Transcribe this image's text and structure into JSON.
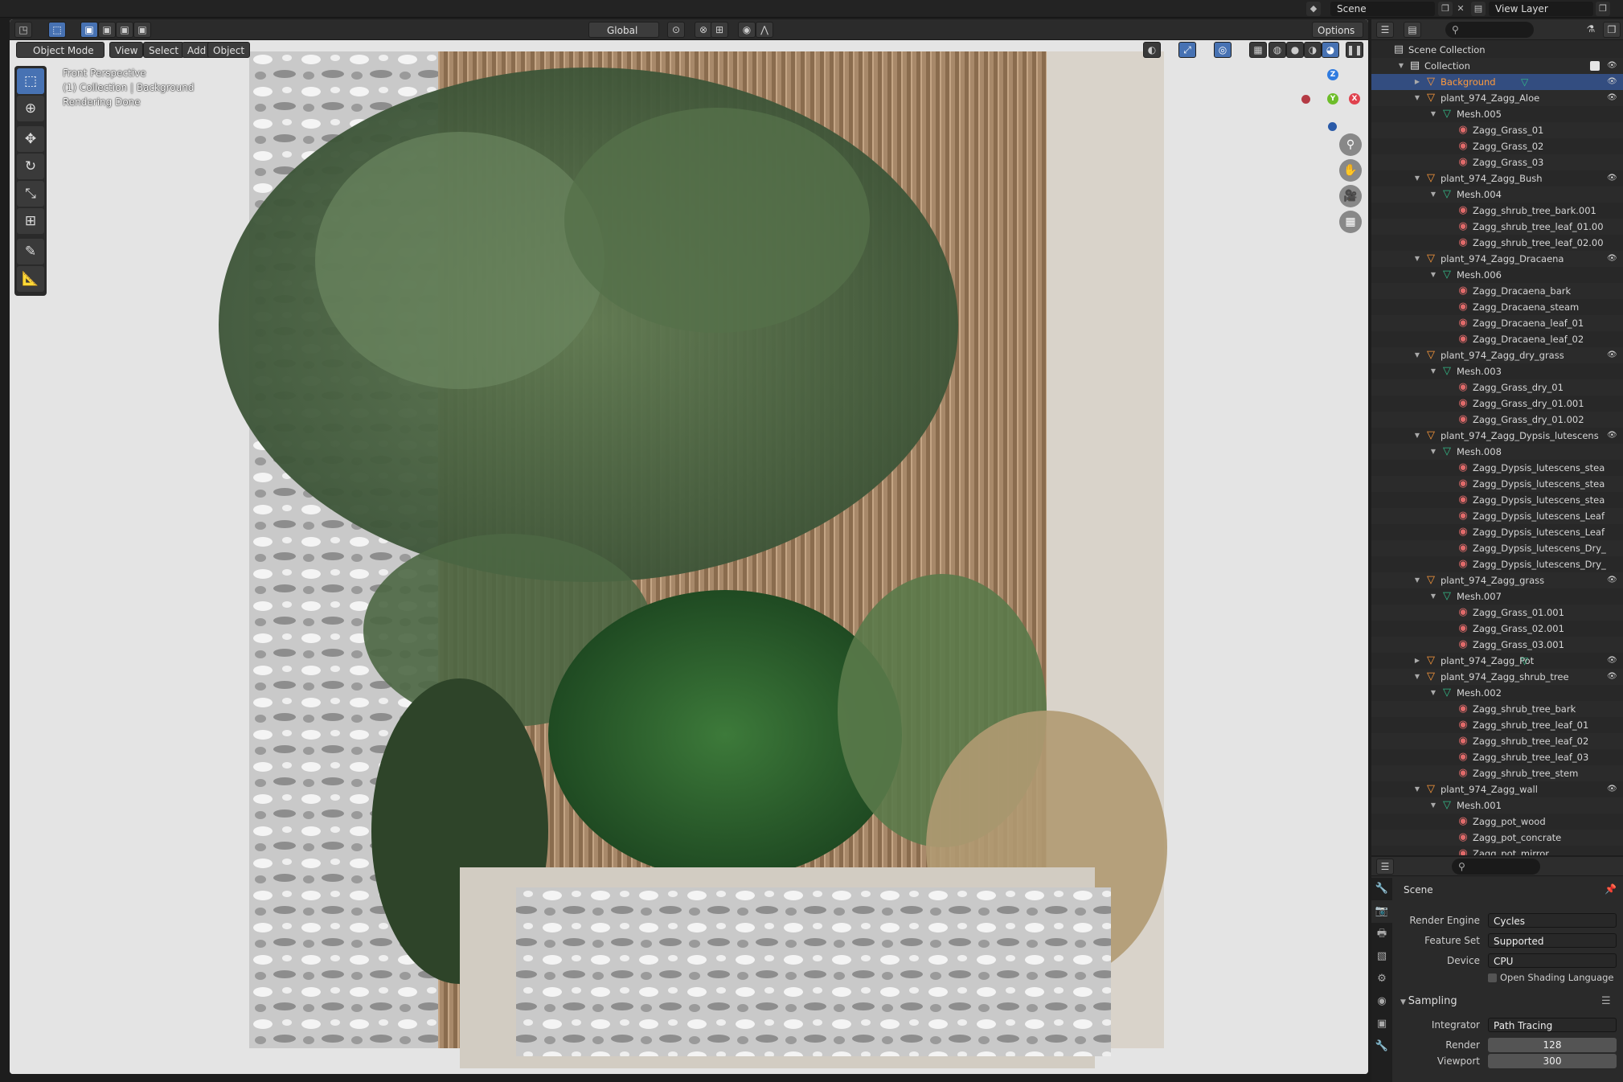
{
  "topbar": {
    "scene_label": "Scene",
    "view_layer_label": "View Layer"
  },
  "viewport": {
    "mode": "Object Mode",
    "menus": [
      "View",
      "Select",
      "Add",
      "Object"
    ],
    "orientation": "Global",
    "options": "Options",
    "overlay_lines": [
      "Front Perspective",
      "(1) Collection | Background",
      "Rendering Done"
    ],
    "gizmo": {
      "z": "Z",
      "y": "Y",
      "x": "X"
    }
  },
  "outliner": {
    "search_placeholder": "",
    "rows": [
      {
        "label": "Scene Collection",
        "depth": 0,
        "icon": "scene-collection-icon",
        "tri": ""
      },
      {
        "label": "Collection",
        "depth": 1,
        "icon": "collection-icon",
        "tri": "▼",
        "check": true,
        "eye": true
      },
      {
        "label": "Background",
        "depth": 2,
        "icon": "object-icon",
        "tri": "▶",
        "eye": true,
        "selected": true,
        "mesh_data": true
      },
      {
        "label": "plant_974_Zagg_Aloe",
        "depth": 2,
        "icon": "object-icon",
        "tri": "▼",
        "eye": true
      },
      {
        "label": "Mesh.005",
        "depth": 3,
        "icon": "mesh-icon",
        "tri": "▼"
      },
      {
        "label": "Zagg_Grass_01",
        "depth": 4,
        "icon": "material-icon"
      },
      {
        "label": "Zagg_Grass_02",
        "depth": 4,
        "icon": "material-icon"
      },
      {
        "label": "Zagg_Grass_03",
        "depth": 4,
        "icon": "material-icon"
      },
      {
        "label": "plant_974_Zagg_Bush",
        "depth": 2,
        "icon": "object-icon",
        "tri": "▼",
        "eye": true
      },
      {
        "label": "Mesh.004",
        "depth": 3,
        "icon": "mesh-icon",
        "tri": "▼"
      },
      {
        "label": "Zagg_shrub_tree_bark.001",
        "depth": 4,
        "icon": "material-icon"
      },
      {
        "label": "Zagg_shrub_tree_leaf_01.00",
        "depth": 4,
        "icon": "material-icon"
      },
      {
        "label": "Zagg_shrub_tree_leaf_02.00",
        "depth": 4,
        "icon": "material-icon"
      },
      {
        "label": "plant_974_Zagg_Dracaena",
        "depth": 2,
        "icon": "object-icon",
        "tri": "▼",
        "eye": true
      },
      {
        "label": "Mesh.006",
        "depth": 3,
        "icon": "mesh-icon",
        "tri": "▼"
      },
      {
        "label": "Zagg_Dracaena_bark",
        "depth": 4,
        "icon": "material-icon"
      },
      {
        "label": "Zagg_Dracaena_steam",
        "depth": 4,
        "icon": "material-icon"
      },
      {
        "label": "Zagg_Dracaena_leaf_01",
        "depth": 4,
        "icon": "material-icon"
      },
      {
        "label": "Zagg_Dracaena_leaf_02",
        "depth": 4,
        "icon": "material-icon"
      },
      {
        "label": "plant_974_Zagg_dry_grass",
        "depth": 2,
        "icon": "object-icon",
        "tri": "▼",
        "eye": true
      },
      {
        "label": "Mesh.003",
        "depth": 3,
        "icon": "mesh-icon",
        "tri": "▼"
      },
      {
        "label": "Zagg_Grass_dry_01",
        "depth": 4,
        "icon": "material-icon"
      },
      {
        "label": "Zagg_Grass_dry_01.001",
        "depth": 4,
        "icon": "material-icon"
      },
      {
        "label": "Zagg_Grass_dry_01.002",
        "depth": 4,
        "icon": "material-icon"
      },
      {
        "label": "plant_974_Zagg_Dypsis_lutescens",
        "depth": 2,
        "icon": "object-icon",
        "tri": "▼",
        "eye": true
      },
      {
        "label": "Mesh.008",
        "depth": 3,
        "icon": "mesh-icon",
        "tri": "▼"
      },
      {
        "label": "Zagg_Dypsis_lutescens_stea",
        "depth": 4,
        "icon": "material-icon"
      },
      {
        "label": "Zagg_Dypsis_lutescens_stea",
        "depth": 4,
        "icon": "material-icon"
      },
      {
        "label": "Zagg_Dypsis_lutescens_stea",
        "depth": 4,
        "icon": "material-icon"
      },
      {
        "label": "Zagg_Dypsis_lutescens_Leaf",
        "depth": 4,
        "icon": "material-icon"
      },
      {
        "label": "Zagg_Dypsis_lutescens_Leaf",
        "depth": 4,
        "icon": "material-icon"
      },
      {
        "label": "Zagg_Dypsis_lutescens_Dry_",
        "depth": 4,
        "icon": "material-icon"
      },
      {
        "label": "Zagg_Dypsis_lutescens_Dry_",
        "depth": 4,
        "icon": "material-icon"
      },
      {
        "label": "plant_974_Zagg_grass",
        "depth": 2,
        "icon": "object-icon",
        "tri": "▼",
        "eye": true
      },
      {
        "label": "Mesh.007",
        "depth": 3,
        "icon": "mesh-icon",
        "tri": "▼"
      },
      {
        "label": "Zagg_Grass_01.001",
        "depth": 4,
        "icon": "material-icon"
      },
      {
        "label": "Zagg_Grass_02.001",
        "depth": 4,
        "icon": "material-icon"
      },
      {
        "label": "Zagg_Grass_03.001",
        "depth": 4,
        "icon": "material-icon"
      },
      {
        "label": "plant_974_Zagg_Pot",
        "depth": 2,
        "icon": "object-icon",
        "tri": "▶",
        "eye": true,
        "mesh_data": true
      },
      {
        "label": "plant_974_Zagg_shrub_tree",
        "depth": 2,
        "icon": "object-icon",
        "tri": "▼",
        "eye": true
      },
      {
        "label": "Mesh.002",
        "depth": 3,
        "icon": "mesh-icon",
        "tri": "▼"
      },
      {
        "label": "Zagg_shrub_tree_bark",
        "depth": 4,
        "icon": "material-icon"
      },
      {
        "label": "Zagg_shrub_tree_leaf_01",
        "depth": 4,
        "icon": "material-icon"
      },
      {
        "label": "Zagg_shrub_tree_leaf_02",
        "depth": 4,
        "icon": "material-icon"
      },
      {
        "label": "Zagg_shrub_tree_leaf_03",
        "depth": 4,
        "icon": "material-icon"
      },
      {
        "label": "Zagg_shrub_tree_stem",
        "depth": 4,
        "icon": "material-icon"
      },
      {
        "label": "plant_974_Zagg_wall",
        "depth": 2,
        "icon": "object-icon",
        "tri": "▼",
        "eye": true
      },
      {
        "label": "Mesh.001",
        "depth": 3,
        "icon": "mesh-icon",
        "tri": "▼"
      },
      {
        "label": "Zagg_pot_wood",
        "depth": 4,
        "icon": "material-icon"
      },
      {
        "label": "Zagg_pot_concrate",
        "depth": 4,
        "icon": "material-icon"
      },
      {
        "label": "Zagg_pot_mirror",
        "depth": 4,
        "icon": "material-icon"
      }
    ]
  },
  "properties": {
    "context": "Scene",
    "render_engine_label": "Render Engine",
    "render_engine": "Cycles",
    "feature_set_label": "Feature Set",
    "feature_set": "Supported",
    "device_label": "Device",
    "device": "CPU",
    "osl_label": "Open Shading Language",
    "sampling_label": "Sampling",
    "integrator_label": "Integrator",
    "integrator": "Path Tracing",
    "render_label": "Render",
    "render_samples": "128",
    "viewport_label": "Viewport",
    "viewport_samples": "300"
  },
  "colors": {
    "accent": "#4772b3",
    "selected_row": "#334d80",
    "object_icon": "#ff9b3c",
    "mesh_icon": "#33bb88",
    "material_icon": "#e06a6a"
  }
}
